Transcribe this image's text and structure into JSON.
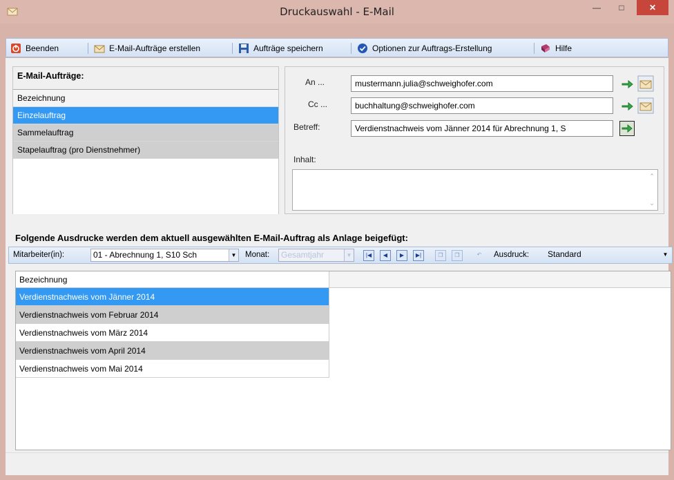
{
  "window": {
    "title": "Druckauswahl - E-Mail"
  },
  "toolbar": {
    "beenden": "Beenden",
    "create": "E-Mail-Aufträge erstellen",
    "save": "Aufträge speichern",
    "options": "Optionen zur Auftrags-Erstellung",
    "help": "Hilfe"
  },
  "left_panel": {
    "title": "E-Mail-Aufträge:",
    "items": [
      "Bezeichnung",
      "Einzelauftrag",
      "Sammelauftrag",
      "Stapelauftrag (pro Dienstnehmer)"
    ]
  },
  "mail": {
    "an_label": "An ...",
    "an_value": "mustermann.julia@schweighofer.com",
    "cc_label": "Cc ...",
    "cc_value": "buchhaltung@schweighofer.com",
    "betreff_label": "Betreff:",
    "betreff_value": "Verdienstnachweis vom Jänner 2014 für Abrechnung 1, S",
    "inhalt_label": "Inhalt:"
  },
  "attachments": {
    "section_title": "Folgende Ausdrucke werden dem aktuell ausgewählten E-Mail-Auftrag als Anlage beigefügt:",
    "mitarbeiter_label": "Mitarbeiter(in):",
    "mitarbeiter_value": "01 - Abrechnung 1, S10 Sch",
    "monat_label": "Monat:",
    "monat_value": "Gesamtjahr",
    "ausdruck_label": "Ausdruck:",
    "ausdruck_value": "Standard",
    "column": "Bezeichnung",
    "rows": [
      "Verdienstnachweis vom Jänner 2014",
      "Verdienstnachweis vom Februar 2014",
      "Verdienstnachweis vom März 2014",
      "Verdienstnachweis vom April 2014",
      "Verdienstnachweis vom Mai 2014"
    ]
  },
  "colors": {
    "selection": "#3399f3",
    "close": "#c7463c",
    "frame": "#d8b3a9"
  }
}
